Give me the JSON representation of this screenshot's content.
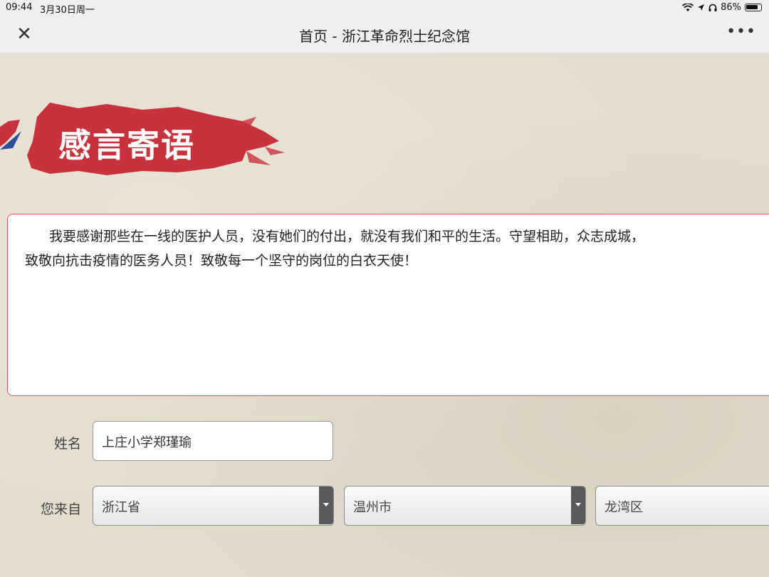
{
  "status_bar": {
    "time": "09:44",
    "date": "3月30日周一",
    "battery": "86%"
  },
  "nav": {
    "title": "首页 - 浙江革命烈士纪念馆"
  },
  "section": {
    "heading": "感言寄语"
  },
  "message": {
    "text_line1": "我要感谢那些在一线的医护人员，没有她们的付出，就没有我们和平的生活。守望相助，众志成城，",
    "text_line2": "致敬向抗击疫情的医务人员！致敬每一个坚守的岗位的白衣天使！"
  },
  "form": {
    "name_label": "姓名",
    "name_value": "上庄小学郑瑾瑜",
    "from_label": "您来自",
    "province": "浙江省",
    "city": "温州市",
    "district": "龙湾区"
  },
  "colors": {
    "accent_red": "#c8323c",
    "background": "#e4ddce"
  }
}
